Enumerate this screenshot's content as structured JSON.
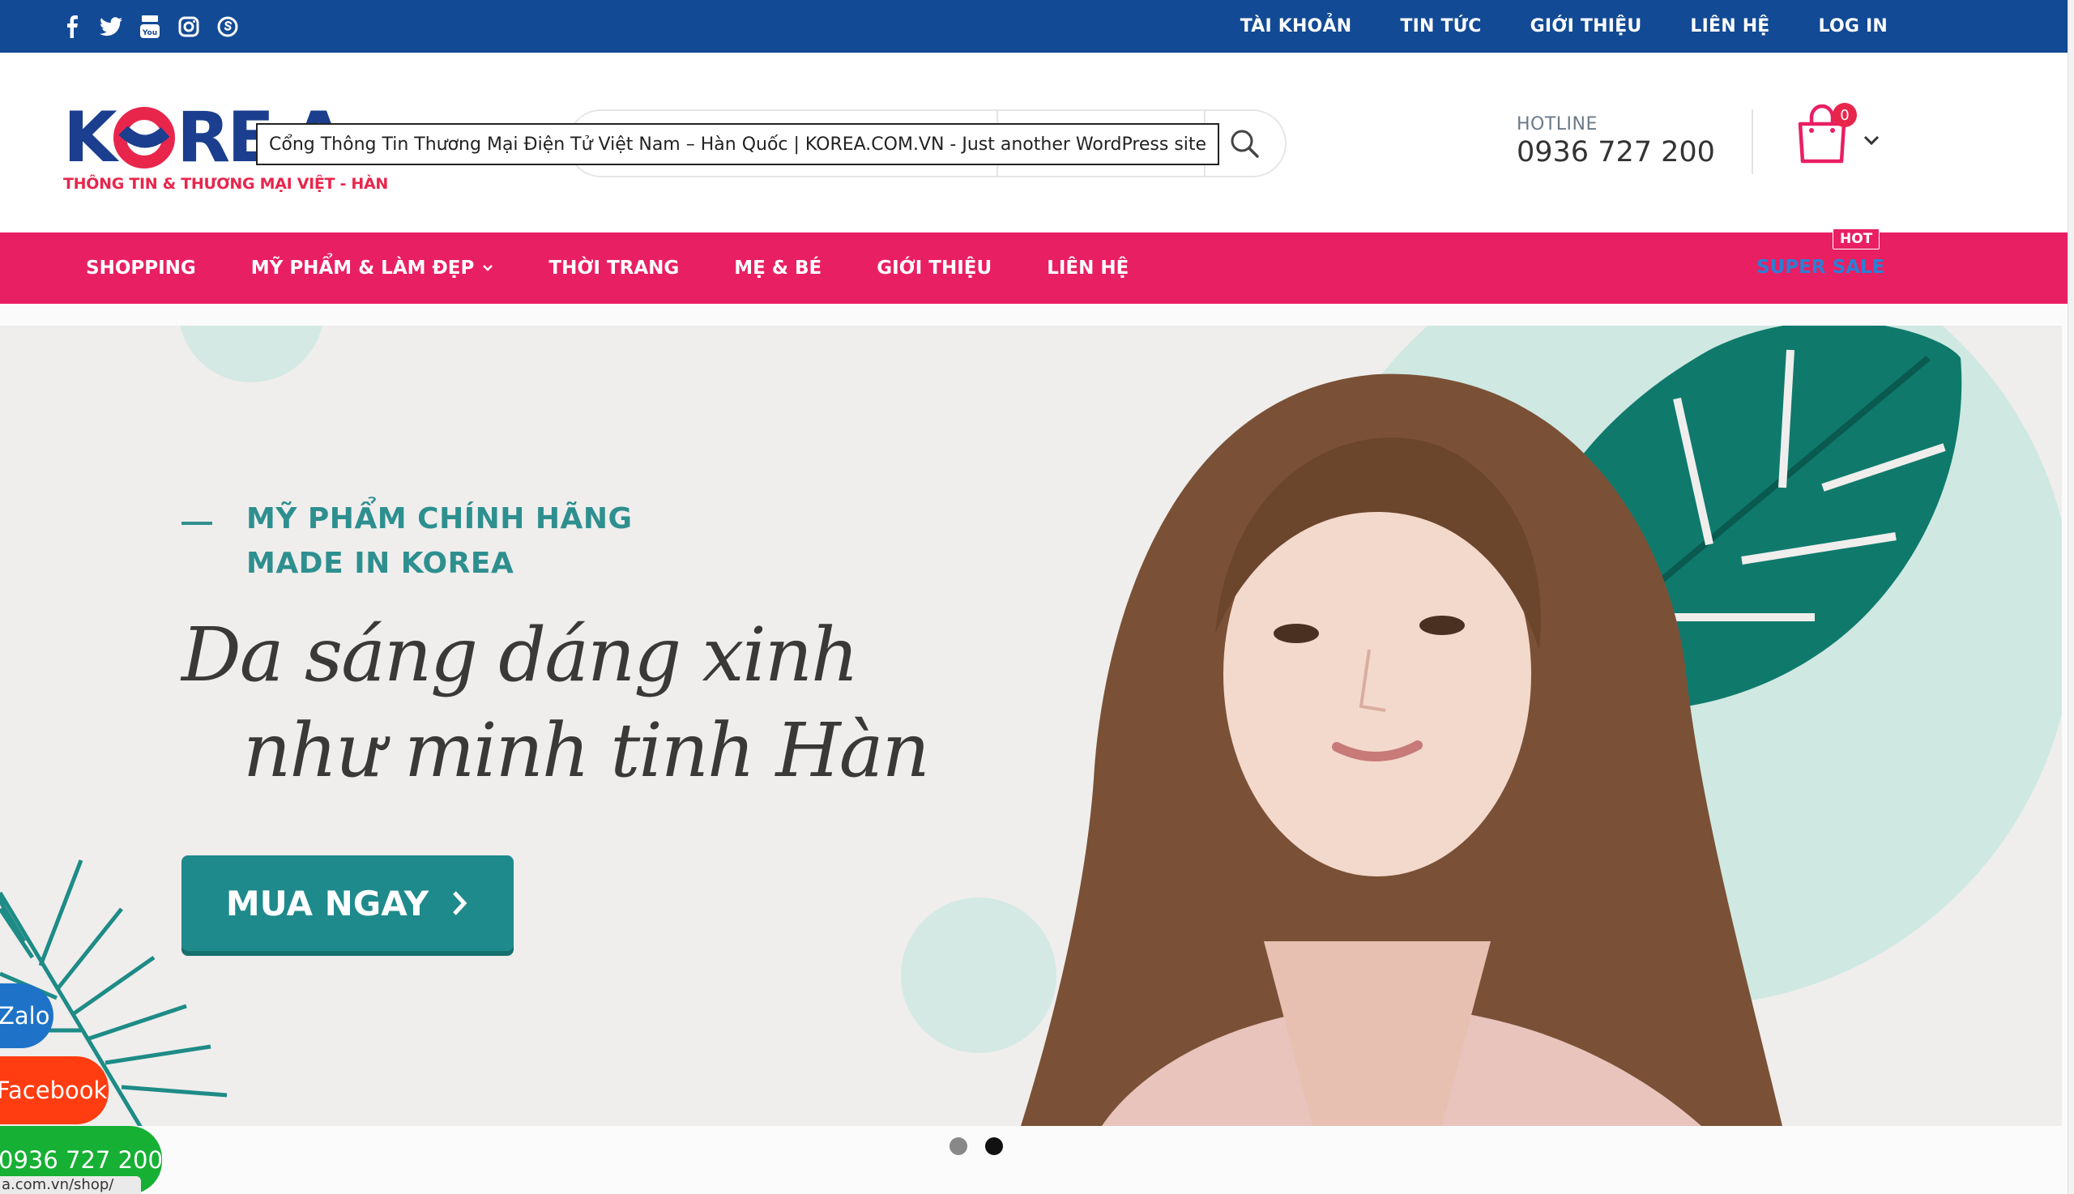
{
  "topbar": {
    "socials": [
      "facebook-icon",
      "twitter-icon",
      "youtube-icon",
      "instagram-icon",
      "skype-icon"
    ],
    "nav": [
      "TÀI KHOẢN",
      "TIN TỨC",
      "GIỚI THIỆU",
      "LIÊN HỆ",
      "LOG IN"
    ]
  },
  "header": {
    "logo_text": "KOREA",
    "logo_sub": "THÔNG TIN & THƯƠNG MẠI VIỆT - HÀN",
    "tooltip": "Cổng Thông Tin Thương Mại Điện Tử Việt Nam – Hàn Quốc | KOREA.COM.VN - Just another WordPress site",
    "hotline_label": "HOTLINE",
    "hotline_number": "0936 727 200",
    "cart_count": "0"
  },
  "mainnav": {
    "items": [
      "SHOPPING",
      "MỸ PHẨM & LÀM ĐẸP",
      "THỜI TRANG",
      "MẸ & BÉ",
      "GIỚI THIỆU",
      "LIÊN HỆ"
    ],
    "super_sale": "SUPER SALE",
    "hot_badge": "HOT"
  },
  "banner": {
    "tagline_1": "MỸ PHẨM CHÍNH HÃNG",
    "tagline_2": "MADE IN KOREA",
    "headline_1": "Da sáng dáng xinh",
    "headline_2": "như minh tinh Hàn",
    "cta": "MUA NGAY",
    "slides": 2,
    "active_slide": 2
  },
  "floating": {
    "zalo": "Zalo",
    "facebook": "Facebook",
    "phone": "0936 727 200",
    "status_url": "a.com.vn/shop/"
  },
  "colors": {
    "topbar": "#124a95",
    "mainnav": "#e91f63",
    "teal": "#1f8a8c",
    "brand_blue": "#1b3e8e",
    "brand_red": "#e8264c"
  }
}
